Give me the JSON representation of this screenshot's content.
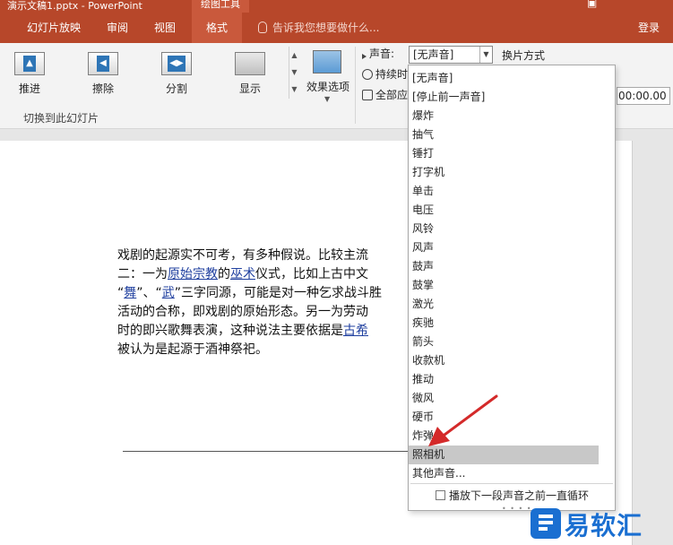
{
  "window": {
    "title": "演示文稿1.pptx - PowerPoint",
    "tools_label": "绘图工具"
  },
  "tabs": [
    {
      "label": "幻灯片放映"
    },
    {
      "label": "审阅"
    },
    {
      "label": "视图"
    },
    {
      "label": "格式",
      "active": true
    }
  ],
  "tell_me": "告诉我您想要做什么...",
  "login": "登录",
  "transitions": {
    "items": [
      {
        "label": "推进",
        "icon": "arrow-up-icon"
      },
      {
        "label": "擦除",
        "icon": "arrow-left-icon"
      },
      {
        "label": "分割",
        "icon": "split-arrows-icon"
      },
      {
        "label": "显示",
        "icon": "reveal-icon"
      }
    ],
    "effect_options": "效果选项",
    "group_label": "切换到此幻灯片"
  },
  "timing": {
    "sound_label": "声音:",
    "sound_value": "[无声音]",
    "duration_label": "持续时",
    "apply_all_label": "全部应",
    "advance_label": "换片方式",
    "time_value": "00:00.00"
  },
  "slide": {
    "lines": [
      [
        {
          "t": "戏剧的起源实不可考，有多种假说。比较主流"
        }
      ],
      [
        {
          "t": "二：一为"
        },
        {
          "t": "原始宗教",
          "link": true
        },
        {
          "t": "的"
        },
        {
          "t": "巫术",
          "link": true
        },
        {
          "t": "仪式，比如上古中文"
        }
      ],
      [
        {
          "t": "“"
        },
        {
          "t": "舞",
          "link": true
        },
        {
          "t": "”、“"
        },
        {
          "t": "武",
          "link": true
        },
        {
          "t": "”三字同源，可能是对一种乞求战斗胜"
        }
      ],
      [
        {
          "t": "活动的合称，即戏剧的原始形态。另一为劳动"
        }
      ],
      [
        {
          "t": "时的即兴歌舞表演，这种说法主要依据是"
        },
        {
          "t": "古希",
          "link": true
        }
      ],
      [
        {
          "t": "被认为是起源于酒神祭祀。"
        }
      ]
    ]
  },
  "sound_menu": {
    "items": [
      "[无声音]",
      "[停止前一声音]",
      "爆炸",
      "抽气",
      "锤打",
      "打字机",
      "单击",
      "电压",
      "风铃",
      "风声",
      "鼓声",
      "鼓掌",
      "激光",
      "疾驰",
      "箭头",
      "收款机",
      "推动",
      "微风",
      "硬币",
      "炸弹",
      "照相机",
      "其他声音..."
    ],
    "selected_index": 20,
    "footer": "播放下一段声音之前一直循环"
  },
  "watermark": {
    "text": "易软汇"
  },
  "colors": {
    "ribbon_accent": "#b7472a",
    "annotation_arrow": "#d42a2a",
    "watermark_blue": "#1a6fd1"
  }
}
